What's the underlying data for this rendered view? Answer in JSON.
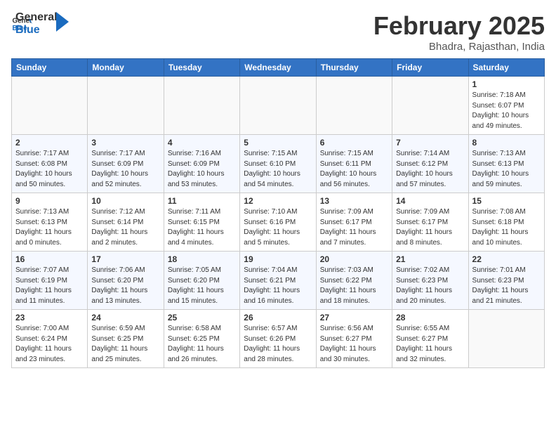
{
  "logo": {
    "text_general": "General",
    "text_blue": "Blue"
  },
  "title": "February 2025",
  "location": "Bhadra, Rajasthan, India",
  "weekdays": [
    "Sunday",
    "Monday",
    "Tuesday",
    "Wednesday",
    "Thursday",
    "Friday",
    "Saturday"
  ],
  "weeks": [
    [
      {
        "day": "",
        "info": ""
      },
      {
        "day": "",
        "info": ""
      },
      {
        "day": "",
        "info": ""
      },
      {
        "day": "",
        "info": ""
      },
      {
        "day": "",
        "info": ""
      },
      {
        "day": "",
        "info": ""
      },
      {
        "day": "1",
        "info": "Sunrise: 7:18 AM\nSunset: 6:07 PM\nDaylight: 10 hours\nand 49 minutes."
      }
    ],
    [
      {
        "day": "2",
        "info": "Sunrise: 7:17 AM\nSunset: 6:08 PM\nDaylight: 10 hours\nand 50 minutes."
      },
      {
        "day": "3",
        "info": "Sunrise: 7:17 AM\nSunset: 6:09 PM\nDaylight: 10 hours\nand 52 minutes."
      },
      {
        "day": "4",
        "info": "Sunrise: 7:16 AM\nSunset: 6:09 PM\nDaylight: 10 hours\nand 53 minutes."
      },
      {
        "day": "5",
        "info": "Sunrise: 7:15 AM\nSunset: 6:10 PM\nDaylight: 10 hours\nand 54 minutes."
      },
      {
        "day": "6",
        "info": "Sunrise: 7:15 AM\nSunset: 6:11 PM\nDaylight: 10 hours\nand 56 minutes."
      },
      {
        "day": "7",
        "info": "Sunrise: 7:14 AM\nSunset: 6:12 PM\nDaylight: 10 hours\nand 57 minutes."
      },
      {
        "day": "8",
        "info": "Sunrise: 7:13 AM\nSunset: 6:13 PM\nDaylight: 10 hours\nand 59 minutes."
      }
    ],
    [
      {
        "day": "9",
        "info": "Sunrise: 7:13 AM\nSunset: 6:13 PM\nDaylight: 11 hours\nand 0 minutes."
      },
      {
        "day": "10",
        "info": "Sunrise: 7:12 AM\nSunset: 6:14 PM\nDaylight: 11 hours\nand 2 minutes."
      },
      {
        "day": "11",
        "info": "Sunrise: 7:11 AM\nSunset: 6:15 PM\nDaylight: 11 hours\nand 4 minutes."
      },
      {
        "day": "12",
        "info": "Sunrise: 7:10 AM\nSunset: 6:16 PM\nDaylight: 11 hours\nand 5 minutes."
      },
      {
        "day": "13",
        "info": "Sunrise: 7:09 AM\nSunset: 6:17 PM\nDaylight: 11 hours\nand 7 minutes."
      },
      {
        "day": "14",
        "info": "Sunrise: 7:09 AM\nSunset: 6:17 PM\nDaylight: 11 hours\nand 8 minutes."
      },
      {
        "day": "15",
        "info": "Sunrise: 7:08 AM\nSunset: 6:18 PM\nDaylight: 11 hours\nand 10 minutes."
      }
    ],
    [
      {
        "day": "16",
        "info": "Sunrise: 7:07 AM\nSunset: 6:19 PM\nDaylight: 11 hours\nand 11 minutes."
      },
      {
        "day": "17",
        "info": "Sunrise: 7:06 AM\nSunset: 6:20 PM\nDaylight: 11 hours\nand 13 minutes."
      },
      {
        "day": "18",
        "info": "Sunrise: 7:05 AM\nSunset: 6:20 PM\nDaylight: 11 hours\nand 15 minutes."
      },
      {
        "day": "19",
        "info": "Sunrise: 7:04 AM\nSunset: 6:21 PM\nDaylight: 11 hours\nand 16 minutes."
      },
      {
        "day": "20",
        "info": "Sunrise: 7:03 AM\nSunset: 6:22 PM\nDaylight: 11 hours\nand 18 minutes."
      },
      {
        "day": "21",
        "info": "Sunrise: 7:02 AM\nSunset: 6:23 PM\nDaylight: 11 hours\nand 20 minutes."
      },
      {
        "day": "22",
        "info": "Sunrise: 7:01 AM\nSunset: 6:23 PM\nDaylight: 11 hours\nand 21 minutes."
      }
    ],
    [
      {
        "day": "23",
        "info": "Sunrise: 7:00 AM\nSunset: 6:24 PM\nDaylight: 11 hours\nand 23 minutes."
      },
      {
        "day": "24",
        "info": "Sunrise: 6:59 AM\nSunset: 6:25 PM\nDaylight: 11 hours\nand 25 minutes."
      },
      {
        "day": "25",
        "info": "Sunrise: 6:58 AM\nSunset: 6:25 PM\nDaylight: 11 hours\nand 26 minutes."
      },
      {
        "day": "26",
        "info": "Sunrise: 6:57 AM\nSunset: 6:26 PM\nDaylight: 11 hours\nand 28 minutes."
      },
      {
        "day": "27",
        "info": "Sunrise: 6:56 AM\nSunset: 6:27 PM\nDaylight: 11 hours\nand 30 minutes."
      },
      {
        "day": "28",
        "info": "Sunrise: 6:55 AM\nSunset: 6:27 PM\nDaylight: 11 hours\nand 32 minutes."
      },
      {
        "day": "",
        "info": ""
      }
    ]
  ]
}
